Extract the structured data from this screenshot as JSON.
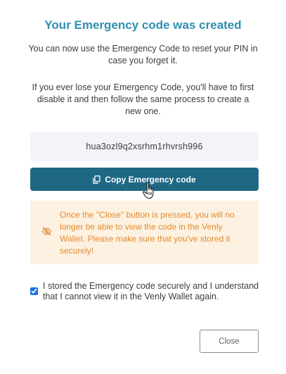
{
  "dialog": {
    "title": "Your Emergency code was created",
    "paragraph1": "You can now use the Emergency Code to reset your PIN in case you forget it.",
    "paragraph2": "If you ever lose your Emergency Code, you'll have to first disable it and then follow the same process to create a new one.",
    "code": "hua3ozl9q2xsrhm1rhvrsh996",
    "copy_button_label": "Copy Emergency code",
    "warning_text": "Once the \"Close\" button is pressed, you will no longer be able to view the code in the Venly Wallet. Please make sure that you've stored it securely!",
    "confirm_checkbox_label": "I stored the Emergency code securely and I understand that I cannot view it in the Venly Wallet again.",
    "close_button_label": "Close"
  },
  "colors": {
    "title": "#2f8fb0",
    "primary_button": "#1e6884",
    "warning_bg": "#fdf1e1",
    "warning_text": "#e38a2e",
    "code_bg": "#f2f4f8"
  },
  "icons": {
    "copy": "copy-icon",
    "warning": "eye-off-icon",
    "cursor": "hand-pointer-cursor"
  },
  "state": {
    "confirm_checked": true
  }
}
